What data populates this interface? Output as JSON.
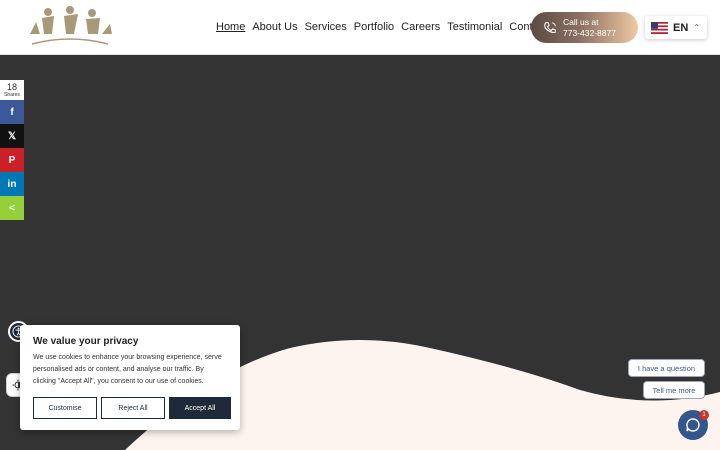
{
  "header": {
    "logo_text": "CLEAN N CLEAR LLC",
    "nav": [
      {
        "label": "Home",
        "active": true
      },
      {
        "label": "About Us"
      },
      {
        "label": "Services"
      },
      {
        "label": "Portfolio"
      },
      {
        "label": "Careers"
      },
      {
        "label": "Testimonial"
      },
      {
        "label": "Contact Us"
      }
    ],
    "call": {
      "line1": "Call us at",
      "line2": "773-432-8877"
    },
    "language": {
      "code": "EN",
      "flag_icon": "us-flag-icon"
    }
  },
  "share": {
    "count": "18",
    "count_label": "Shares",
    "buttons": [
      {
        "icon": "facebook-icon",
        "glyph": "f",
        "color": "#3b5998"
      },
      {
        "icon": "x-icon",
        "glyph": "𝕏",
        "color": "#111111"
      },
      {
        "icon": "pinterest-icon",
        "glyph": "P",
        "color": "#cb2027"
      },
      {
        "icon": "linkedin-icon",
        "glyph": "in",
        "color": "#0077b5"
      },
      {
        "icon": "sharethis-icon",
        "glyph": "<",
        "color": "#95d03a"
      }
    ]
  },
  "cookie": {
    "title": "We value your privacy",
    "body": "We use cookies to enhance your browsing experience, serve personalised ads or content, and analyse our traffic. By clicking \"Accept All\", you consent to our use of cookies.",
    "customise": "Customise",
    "reject": "Reject All",
    "accept": "Accept All"
  },
  "chat": {
    "question": "I have a question",
    "tell_more": "Tell me more",
    "badge": "1"
  },
  "colors": {
    "hero_bg": "#333333",
    "wave": "#fdf4ef",
    "brand_dark": "#1e2a3a"
  }
}
